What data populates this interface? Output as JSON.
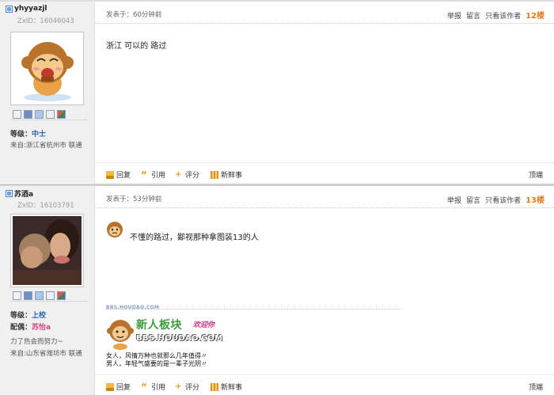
{
  "posts": [
    {
      "id": "12",
      "username": "yhyyazjl",
      "zxid": "ZxID：16046043",
      "level_label": "等级：",
      "level": "中士",
      "from": "来自:浙江省杭州市 联通",
      "time": "发表于：60分钟前",
      "actions": [
        "举报",
        "留言",
        "只看该作者"
      ],
      "floor": "12楼",
      "content": "浙江 可以的  路过",
      "footer": [
        "回复",
        "引用",
        "评分",
        "新鲜事"
      ],
      "top": "顶端"
    },
    {
      "id": "13",
      "username": "苏酒a",
      "zxid": "ZxID：16103791",
      "level_label": "等级：",
      "level": "上校",
      "mate_label": "配偶：",
      "mate": "苏怡a",
      "motto": "力了热会而努力~",
      "from": "来自:山东省潍坊市 联通",
      "time": "发表于：53分钟前",
      "actions": [
        "举报",
        "留言",
        "只看该作者"
      ],
      "floor": "13楼",
      "content": "不懂的路过，鄙视那种拿图装13的人",
      "signature": {
        "url": "BBS.HOUDAO.COM",
        "banner_title": "新人板块",
        "banner_tag": "欢迎你",
        "banner_domain": "BBS.HOUDAO.COM",
        "line1": "女人，风情万种也就那么几年值得〃",
        "line2": "男人，年轻气盛要的是一辈子光阴〃"
      },
      "footer": [
        "回复",
        "引用",
        "评分",
        "新鲜事"
      ],
      "top": "顶端"
    }
  ],
  "colors": {
    "floor": "#e67d22",
    "level": "#2c63b8",
    "mate": "#d0457b"
  }
}
